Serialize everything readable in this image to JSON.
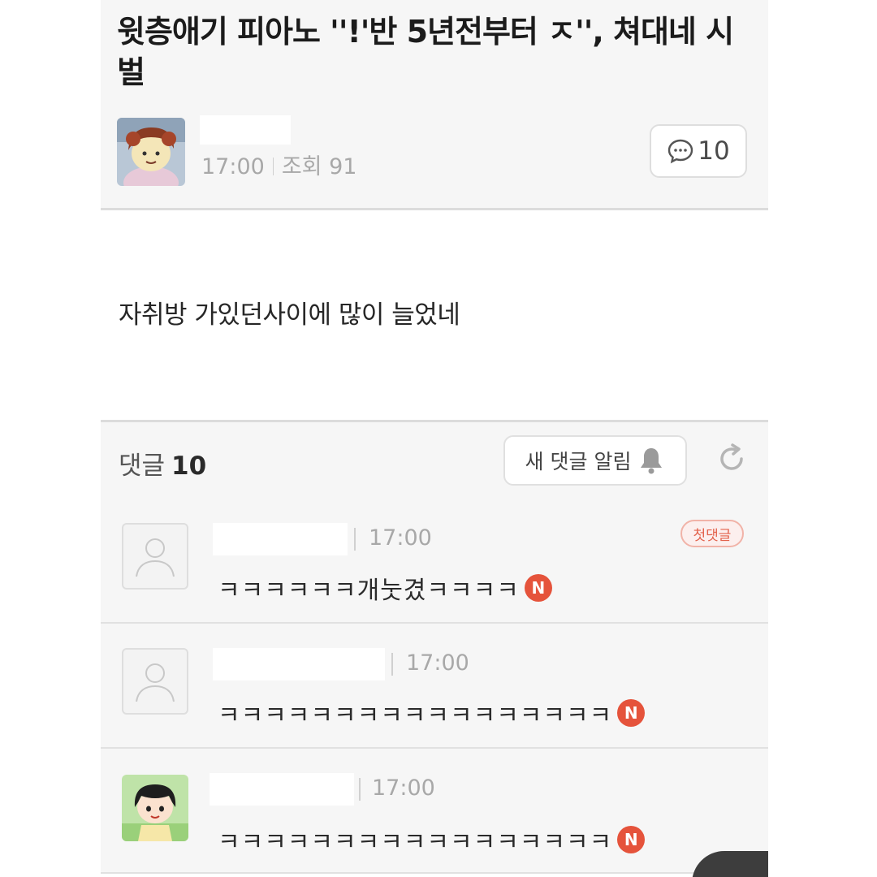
{
  "post": {
    "title": "윗층애기 피아노 ''!'반 5년전부터 ㅈ'', 쳐대네 시벌",
    "time": "17:00",
    "views_label": "조회 91",
    "comment_count": "10",
    "body": "자취방 가있던사이에 많이 늘었네"
  },
  "comments_section": {
    "title": "댓글",
    "count": "10",
    "notify_label": "새 댓글 알림"
  },
  "comments": [
    {
      "time": "17:00",
      "text": "ㅋㅋㅋㅋㅋㅋ개눗겼ㅋㅋㅋㅋ",
      "badge": "N",
      "first_label": "첫댓글"
    },
    {
      "time": "17:00",
      "text": "ㅋㅋㅋㅋㅋㅋㅋㅋㅋㅋㅋㅋㅋㅋㅋㅋㅋ",
      "badge": "N"
    },
    {
      "time": "17:00",
      "text": "ㅋㅋㅋㅋㅋㅋㅋㅋㅋㅋㅋㅋㅋㅋㅋㅋㅋ",
      "badge": "N"
    }
  ],
  "colors": {
    "header_bg": "#f6f6f6",
    "new_badge": "#e5533b",
    "first_badge_text": "#e3624c"
  },
  "icons": {
    "comment_bubble": "speech-bubble-icon",
    "bell": "bell-icon",
    "refresh": "refresh-icon",
    "default_avatar": "default-profile-icon"
  }
}
